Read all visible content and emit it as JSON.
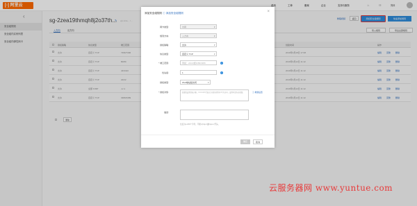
{
  "topbar": {
    "logo": "阿里云",
    "nav": [
      "费用",
      "工单",
      "备案",
      "企业",
      "支持与服务"
    ]
  },
  "sidebar": {
    "back_icon": "chevron-left-icon",
    "items": [
      "安全组规则",
      "安全组内实例列表",
      "安全组内弹性网卡"
    ]
  },
  "main": {
    "title": "sg-2zea19thmqh8j2o37th...",
    "title_icon": "edit-icon",
    "crumb": "vpc-2ze... / ...",
    "tabs": [
      "入方向",
      "出方向"
    ],
    "buttons": {
      "help": "教程视频",
      "back": "返回",
      "add_rule": "添加安全组规则",
      "quick_add": "快速添加规则",
      "import": "导入规则",
      "export": "导出全部规则"
    },
    "table": {
      "headers": [
        "授权策略",
        "协议类型",
        "端口范围",
        "授权类型",
        "授权对象",
        "描述",
        "优先级",
        "创建时间",
        "操作"
      ],
      "rows": [
        [
          "允许",
          "自定义 TCP",
          "7396/7396",
          "地址段访问",
          "0.0.0.0/0",
          "-",
          "1",
          "2019年3月18日 17:08"
        ],
        [
          "允许",
          "自定义 TCP",
          "80/80",
          "地址段访问",
          "0.0.0.0/0",
          "-",
          "1",
          "2019年3月12日 11:12"
        ],
        [
          "允许",
          "自定义 TCP",
          "443/443",
          "地址段访问",
          "0.0.0.0/0",
          "-",
          "1",
          "2019年3月12日 11:12"
        ],
        [
          "允许",
          "自定义 TCP",
          "22/22",
          "地址段访问",
          "0.0.0.0/0",
          "-",
          "1",
          "2019年3月12日 11:12"
        ],
        [
          "允许",
          "全部 ICMP",
          "-1/-1",
          "地址段访问",
          "0.0.0.0/0",
          "-",
          "1",
          "2019年3月12日 11:12"
        ],
        [
          "允许",
          "自定义 TCP",
          "3389/3389",
          "地址段访问",
          "0.0.0.0/0",
          "-",
          "1",
          "2019年3月12日 11:12"
        ]
      ],
      "actions": [
        "编辑",
        "克隆",
        "删除"
      ],
      "delete_button": "删除"
    }
  },
  "modal": {
    "title_prefix": "添加安全组规则",
    "title_link": "添加安全组规则",
    "close_icon": "close-icon",
    "fields": {
      "nic_type_label": "网卡类型:",
      "nic_type_value": "内网",
      "direction_label": "规则方向:",
      "direction_value": "入方向",
      "policy_label": "授权策略:",
      "policy_value": "允许",
      "protocol_label": "协议类型:",
      "protocol_value": "自定义 TCP",
      "port_label": "* 端口范围:",
      "port_placeholder": "例如：22/22或3389/3389",
      "priority_label": "优先级:",
      "priority_value": "1",
      "auth_type_label": "授权类型:",
      "auth_type_value": "IPv4地址段访问",
      "auth_obj_label": "* 授权对象:",
      "auth_obj_placeholder": "请谨慎设置授权对象，0.0.0.0/0 代表允许或拒绝所有 IP 的访问，设置时请务必谨慎。",
      "auth_obj_link": "教我设置",
      "desc_label": "描述:",
      "desc_hint": "长度为2-256个字符，不能以http://或https://开头。"
    },
    "ok_button": "确定",
    "cancel_button": "取消"
  },
  "watermark": "云服务器网 www.yuntue.com"
}
